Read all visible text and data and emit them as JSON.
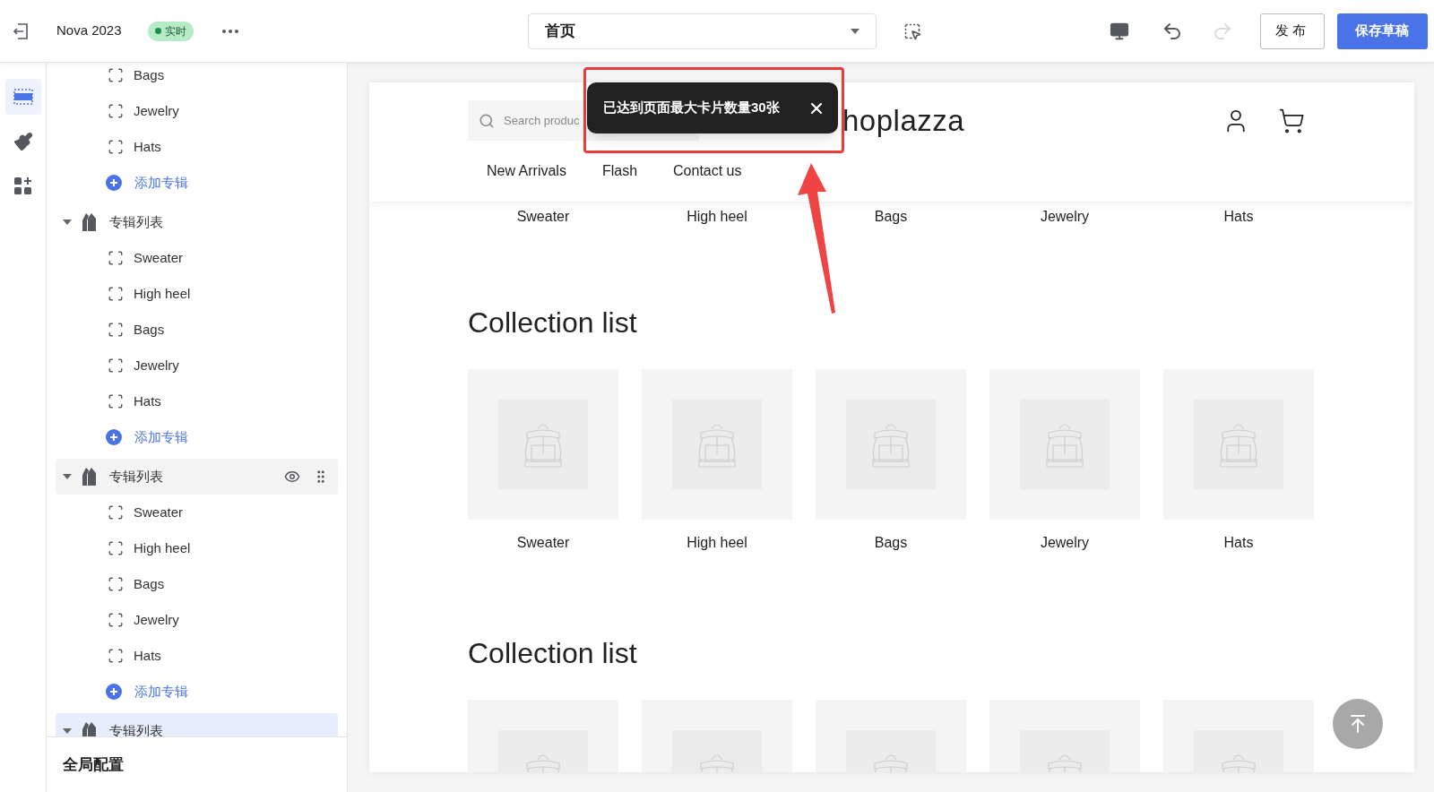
{
  "topbar": {
    "theme_name": "Nova 2023",
    "status": "实时",
    "page_select": {
      "value": "首页"
    },
    "redo_disabled": true,
    "actions": [
      {
        "label": "发布",
        "kind": "outline"
      },
      {
        "label": "保存草稿",
        "kind": "primary"
      }
    ]
  },
  "rail": [
    {
      "kind": "sections",
      "selected": true
    },
    {
      "kind": "theme",
      "selected": false
    },
    {
      "kind": "apps",
      "selected": false
    }
  ],
  "sidebar": {
    "groups": [
      {
        "items": [
          "Bags",
          "Jewelry",
          "Hats"
        ],
        "add_label": "添加专辑"
      },
      {
        "title": "专辑列表",
        "expanded": true,
        "hovered": false,
        "selected": false,
        "items": [
          "Sweater",
          "High heel",
          "Bags",
          "Jewelry",
          "Hats"
        ],
        "add_label": "添加专辑"
      },
      {
        "title": "专辑列表",
        "expanded": true,
        "hovered": true,
        "selected": false,
        "items": [
          "Sweater",
          "High heel",
          "Bags",
          "Jewelry",
          "Hats"
        ],
        "add_label": "添加专辑"
      },
      {
        "title": "专辑列表",
        "expanded": true,
        "hovered": false,
        "selected": true
      }
    ],
    "footer": "全局配置"
  },
  "preview": {
    "search": {
      "placeholder": "Search produc"
    },
    "logo": "hoplazza",
    "nav": [
      "New Arrivals",
      "Flash",
      "Contact us"
    ],
    "top_labels": [
      "Sweater",
      "High heel",
      "Bags",
      "Jewelry",
      "Hats"
    ],
    "sections": [
      {
        "title": "Collection list",
        "cards": [
          {
            "kind": "picture",
            "label": "Sweater"
          },
          {
            "kind": "picture",
            "label": "High heel"
          },
          {
            "kind": "picture",
            "label": "Bags"
          },
          {
            "kind": "picture",
            "label": "Jewelry"
          },
          {
            "kind": "picture",
            "label": "Hats"
          }
        ]
      },
      {
        "title": "Collection list"
      }
    ]
  },
  "toast": {
    "message": "已达到页面最大卡片数量30张"
  }
}
